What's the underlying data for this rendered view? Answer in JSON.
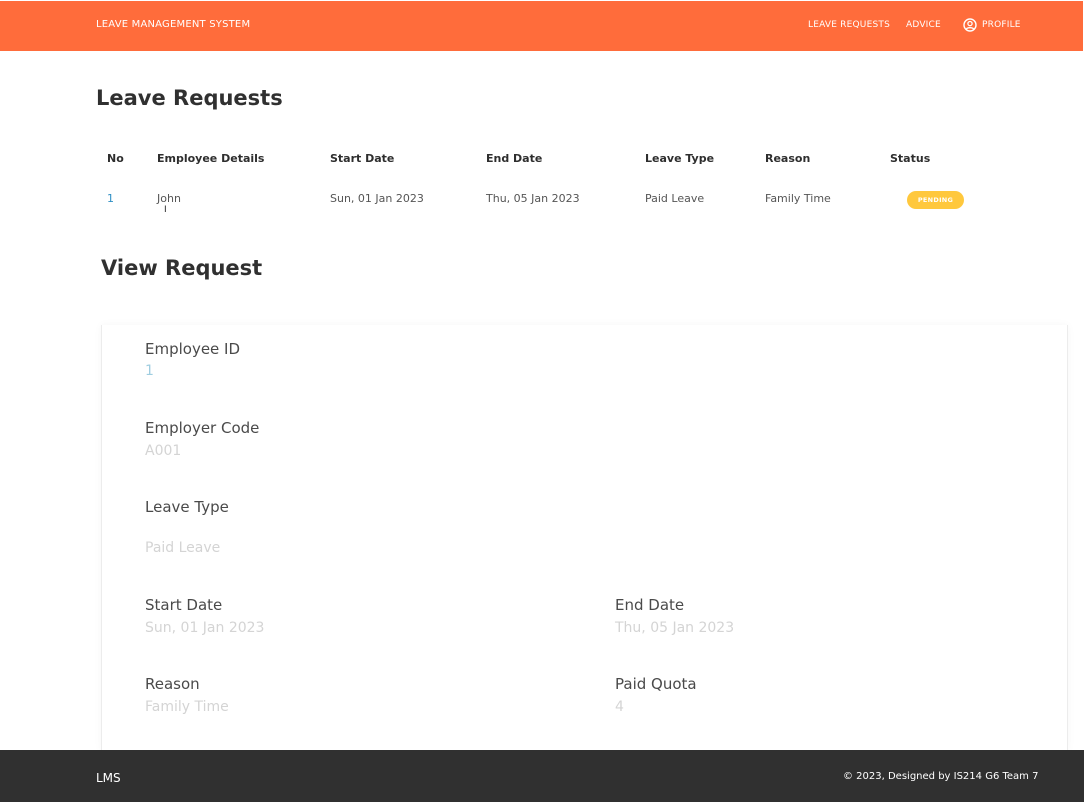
{
  "navbar": {
    "brand": "LEAVE MANAGEMENT SYSTEM",
    "links": [
      "LEAVE REQUESTS",
      "ADVICE",
      "PROFILE"
    ],
    "profile_icon": "user-circle-icon",
    "accent_color": "#ff6c3b"
  },
  "page_title": "Leave Requests",
  "table": {
    "columns": [
      "No",
      "Employee Details",
      "Start Date",
      "End Date",
      "Leave Type",
      "Reason",
      "Status"
    ],
    "rows": [
      {
        "no": "1",
        "employee": "John",
        "start_date": "Sun, 01 Jan 2023",
        "end_date": "Thu, 05 Jan 2023",
        "leave_type": "Paid Leave",
        "reason": "Family Time",
        "status": "PENDING",
        "status_color": "#ffc83d"
      }
    ]
  },
  "view_request": {
    "title": "View Request",
    "employee_id": {
      "label": "Employee ID",
      "value": "1"
    },
    "employer_code": {
      "label": "Employer Code",
      "value": "A001"
    },
    "leave_type": {
      "label": "Leave Type",
      "value": "Paid Leave"
    },
    "start_date": {
      "label": "Start Date",
      "value": "Sun, 01 Jan 2023"
    },
    "end_date": {
      "label": "End Date",
      "value": "Thu, 05 Jan 2023"
    },
    "reason": {
      "label": "Reason",
      "value": "Family Time"
    },
    "paid_quota": {
      "label": "Paid Quota",
      "value": "4"
    }
  },
  "footer": {
    "brand": "LMS",
    "copyright": "© 2023, Designed by IS214 G6 Team 7"
  }
}
